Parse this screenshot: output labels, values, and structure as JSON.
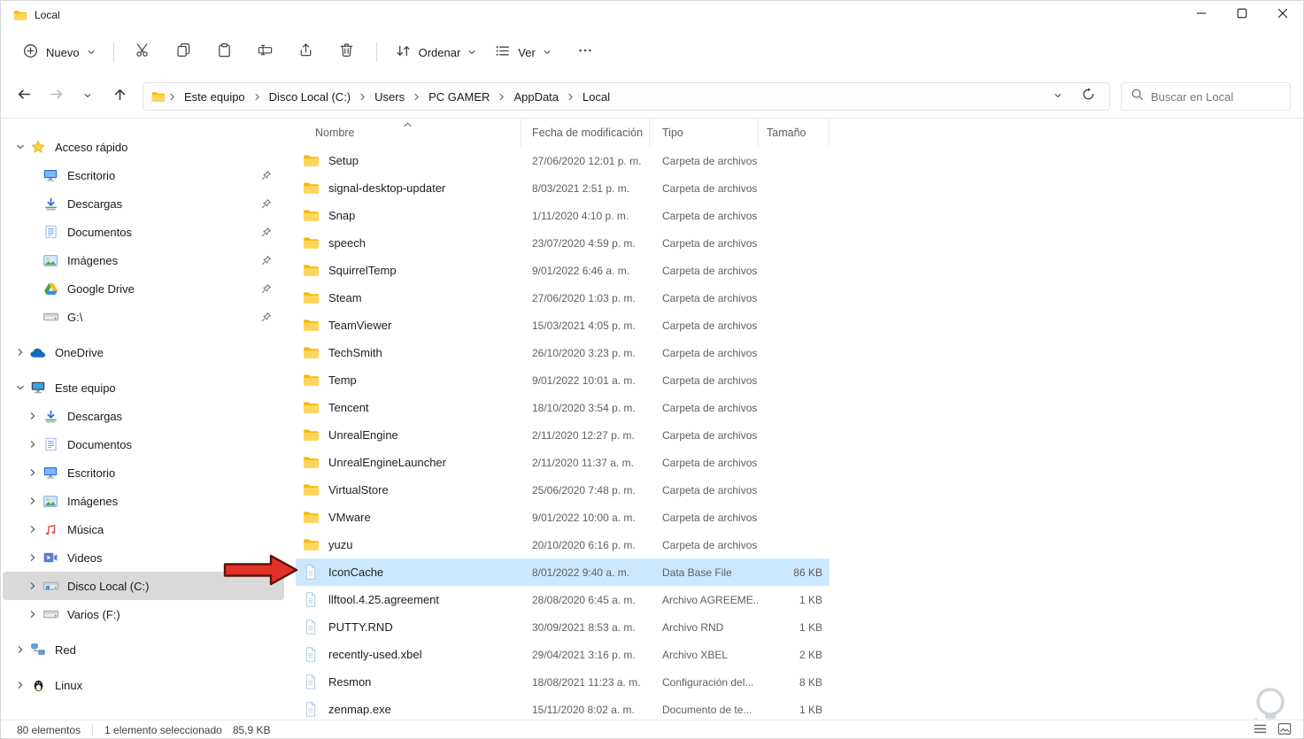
{
  "window": {
    "title": "Local"
  },
  "toolbar": {
    "new_label": "Nuevo",
    "sort_label": "Ordenar",
    "view_label": "Ver"
  },
  "navbar": {
    "breadcrumb": [
      "Este equipo",
      "Disco Local (C:)",
      "Users",
      "PC GAMER",
      "AppData",
      "Local"
    ],
    "search_placeholder": "Buscar en Local"
  },
  "sidebar": {
    "items": [
      {
        "label": "Acceso rápido",
        "icon": "star",
        "level": 0,
        "chevron": "down",
        "pinned": false
      },
      {
        "label": "Escritorio",
        "icon": "desktop",
        "level": 1,
        "chevron": "none",
        "pinned": true
      },
      {
        "label": "Descargas",
        "icon": "downloads",
        "level": 1,
        "chevron": "none",
        "pinned": true
      },
      {
        "label": "Documentos",
        "icon": "documents",
        "level": 1,
        "chevron": "none",
        "pinned": true
      },
      {
        "label": "Imágenes",
        "icon": "pictures",
        "level": 1,
        "chevron": "none",
        "pinned": true
      },
      {
        "label": "Google Drive",
        "icon": "gdrive",
        "level": 1,
        "chevron": "none",
        "pinned": true
      },
      {
        "label": "G:\\",
        "icon": "drive",
        "level": 1,
        "chevron": "none",
        "pinned": true
      },
      {
        "label": "OneDrive",
        "icon": "onedrive",
        "level": 0,
        "chevron": "right",
        "spacer": true
      },
      {
        "label": "Este equipo",
        "icon": "computer",
        "level": 0,
        "chevron": "down",
        "spacer": true
      },
      {
        "label": "Descargas",
        "icon": "downloads",
        "level": 1,
        "chevron": "right"
      },
      {
        "label": "Documentos",
        "icon": "documents",
        "level": 1,
        "chevron": "right"
      },
      {
        "label": "Escritorio",
        "icon": "desktop",
        "level": 1,
        "chevron": "right"
      },
      {
        "label": "Imágenes",
        "icon": "pictures",
        "level": 1,
        "chevron": "right"
      },
      {
        "label": "Música",
        "icon": "music",
        "level": 1,
        "chevron": "right"
      },
      {
        "label": "Videos",
        "icon": "videos",
        "level": 1,
        "chevron": "right"
      },
      {
        "label": "Disco Local (C:)",
        "icon": "diskwin",
        "level": 1,
        "chevron": "right",
        "selected": true
      },
      {
        "label": "Varios (F:)",
        "icon": "drive",
        "level": 1,
        "chevron": "right"
      },
      {
        "label": "Red",
        "icon": "network",
        "level": 0,
        "chevron": "right",
        "spacer": true
      },
      {
        "label": "Linux",
        "icon": "linux",
        "level": 0,
        "chevron": "right",
        "spacer": true
      }
    ]
  },
  "files": {
    "columns": [
      "Nombre",
      "Fecha de modificación",
      "Tipo",
      "Tamaño"
    ],
    "sort_column": "Nombre",
    "sort_direction": "ascending",
    "rows": [
      {
        "name": "Setup",
        "icon": "folder",
        "date": "27/06/2020 12:01 p. m.",
        "type": "Carpeta de archivos",
        "size": ""
      },
      {
        "name": "signal-desktop-updater",
        "icon": "folder",
        "date": "8/03/2021 2:51 p. m.",
        "type": "Carpeta de archivos",
        "size": ""
      },
      {
        "name": "Snap",
        "icon": "folder",
        "date": "1/11/2020 4:10 p. m.",
        "type": "Carpeta de archivos",
        "size": ""
      },
      {
        "name": "speech",
        "icon": "folder",
        "date": "23/07/2020 4:59 p. m.",
        "type": "Carpeta de archivos",
        "size": ""
      },
      {
        "name": "SquirrelTemp",
        "icon": "folder",
        "date": "9/01/2022 6:46 a. m.",
        "type": "Carpeta de archivos",
        "size": ""
      },
      {
        "name": "Steam",
        "icon": "folder",
        "date": "27/06/2020 1:03 p. m.",
        "type": "Carpeta de archivos",
        "size": ""
      },
      {
        "name": "TeamViewer",
        "icon": "folder",
        "date": "15/03/2021 4:05 p. m.",
        "type": "Carpeta de archivos",
        "size": ""
      },
      {
        "name": "TechSmith",
        "icon": "folder",
        "date": "26/10/2020 3:23 p. m.",
        "type": "Carpeta de archivos",
        "size": ""
      },
      {
        "name": "Temp",
        "icon": "folder",
        "date": "9/01/2022 10:01 a. m.",
        "type": "Carpeta de archivos",
        "size": ""
      },
      {
        "name": "Tencent",
        "icon": "folder",
        "date": "18/10/2020 3:54 p. m.",
        "type": "Carpeta de archivos",
        "size": ""
      },
      {
        "name": "UnrealEngine",
        "icon": "folder",
        "date": "2/11/2020 12:27 p. m.",
        "type": "Carpeta de archivos",
        "size": ""
      },
      {
        "name": "UnrealEngineLauncher",
        "icon": "folder",
        "date": "2/11/2020 11:37 a. m.",
        "type": "Carpeta de archivos",
        "size": ""
      },
      {
        "name": "VirtualStore",
        "icon": "folder",
        "date": "25/06/2020 7:48 p. m.",
        "type": "Carpeta de archivos",
        "size": ""
      },
      {
        "name": "VMware",
        "icon": "folder",
        "date": "9/01/2022 10:00 a. m.",
        "type": "Carpeta de archivos",
        "size": ""
      },
      {
        "name": "yuzu",
        "icon": "folder",
        "date": "20/10/2020 6:16 p. m.",
        "type": "Carpeta de archivos",
        "size": ""
      },
      {
        "name": "IconCache",
        "icon": "file",
        "date": "8/01/2022 9:40 a. m.",
        "type": "Data Base File",
        "size": "86 KB",
        "selected": true
      },
      {
        "name": "llftool.4.25.agreement",
        "icon": "file",
        "date": "28/08/2020 6:45 a. m.",
        "type": "Archivo AGREEME...",
        "size": "1 KB"
      },
      {
        "name": "PUTTY.RND",
        "icon": "file",
        "date": "30/09/2021 8:53 a. m.",
        "type": "Archivo RND",
        "size": "1 KB"
      },
      {
        "name": "recently-used.xbel",
        "icon": "file",
        "date": "29/04/2021 3:16 p. m.",
        "type": "Archivo XBEL",
        "size": "2 KB"
      },
      {
        "name": "Resmon",
        "icon": "file",
        "date": "18/08/2021 11:23 a. m.",
        "type": "Configuración del...",
        "size": "8 KB"
      },
      {
        "name": "zenmap.exe",
        "icon": "file",
        "date": "15/11/2020 8:02 a. m.",
        "type": "Documento de te...",
        "size": "1 KB"
      }
    ]
  },
  "statusbar": {
    "item_count": "80 elementos",
    "selection": "1 elemento seleccionado",
    "selection_size": "85,9 KB"
  },
  "colors": {
    "selection_blue": "#cce8ff",
    "sidebar_selected_gray": "#d9d9d9",
    "folder_yellow": "#ffd65c",
    "annotation_arrow_red": "#e23128"
  }
}
